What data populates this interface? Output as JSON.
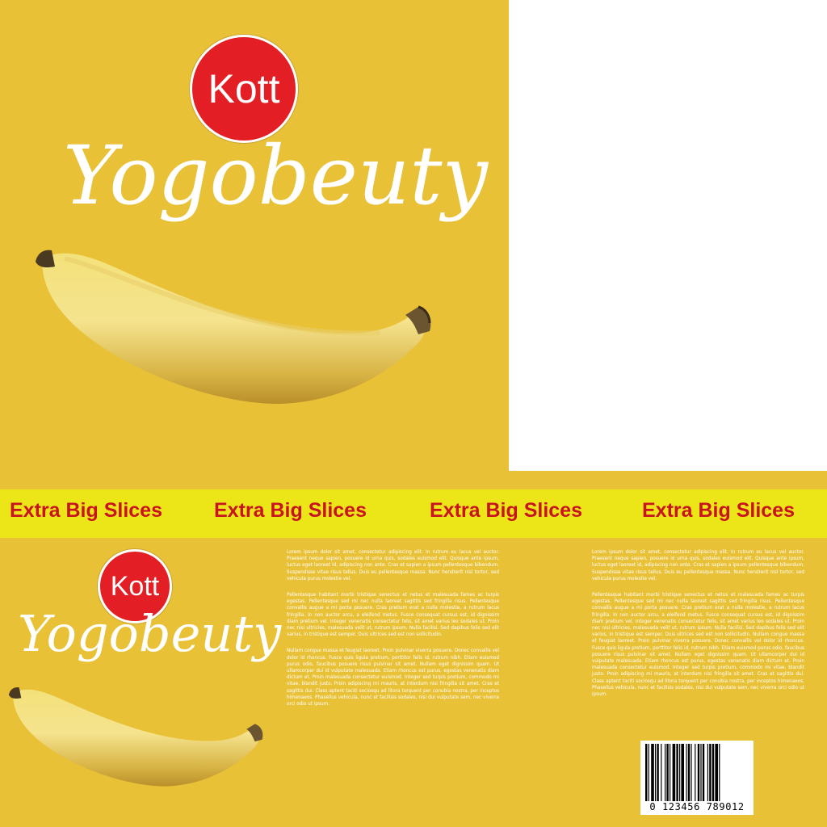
{
  "brand": {
    "logo_text": "Kott",
    "product_name": "Yogobeuty"
  },
  "stripe": {
    "items": [
      "Extra Big Slices",
      "Extra Big Slices",
      "Extra Big Slices",
      "Extra Big Slices"
    ]
  },
  "body_text": {
    "column_1": [
      "Lorem ipsum dolor sit amet, consectetur adipiscing elit. In rutrum eu lacus vel auctor. Praesent neque sapien, posuere id urna quis, sodales euismod elit. Quisque ante ipsum, luctus eget laoreet id, adipiscing non ante. Cras et sapien a ipsum pellentesque bibendum. Suspendisse vitae risus tellus. Duis eu pellentesque massa. Nunc hendrerit nisl tortor, sed vehicula purus molestie vel.",
      "Pellentesque habitant morbi tristique senectus et netus et malesuada fames ac turpis egestas. Pellentesque sed mi nec nulla laoreet sagittis sed fringilla risus. Pellentesque convallis augue a mi porta posuere. Cras pretium erat a nulla molestie, a rutrum lacus fringilla. In non auctor arcu, a eleifend metus. Fusce consequat cursus est, id dignissim diam pretium vel. Integer venenatis consectetur felis, sit amet varius leo sodales ut. Proin nec nisi ultricies, malesuada velit ut, rutrum ipsum. Nulla facilisi. Sed dapibus felis sed elit varius, in tristique est semper. Duis ultrices sed est non sollicitudin.",
      "Nullam congue massa et feugiat laoreet. Proin pulvinar viverra posuere. Donec convallis vel dolor id rhoncus. Fusce quis ligula pretium, porttitor felis id, rutrum nibh. Etiam euismod purus odio, faucibus posuere risus pulvinar sit amet. Nullam eget dignissim quam. Ut ullamcorper dui id vulputate malesuada. Etiam rhoncus est purus, egestas venenatis diam dictum et. Proin malesuada consectetur euismod. Integer sed turpis pretium, commodo mi vitae, blandit justo. Proin adipiscing mi mauris, at interdum nisi fringilla sit amet. Cras et sagittis dui. Class aptent taciti sociosqu ad litora torquent per conubia nostra, per inceptos himenaeos. Phasellus vehicula, nunc et facilisis sodales, nisi dui vulputate sem, nec viverra orci odio ut ipsum."
    ],
    "column_2": [
      "Lorem ipsum dolor sit amet, consectetur adipiscing elit. In rutrum eu lacus vel auctor. Praesent neque sapien, posuere id urna quis, sodales euismod elit. Quisque ante ipsum, luctus eget laoreet id, adipiscing non ante. Cras et sapien a ipsum pellentesque bibendum. Suspendisse vitae risus tellus. Duis eu pellentesque massa. Nunc hendrerit nisl tortor, sed vehicula purus molestie vel.",
      "Pellentesque habitant morbi tristique senectus et netus et malesuada fames ac turpis egestas. Pellentesque sed mi nec nulla laoreet sagittis sed fringilla risus. Pellentesque convallis augue a mi porta posuere. Cras pretium erat a nulla molestie, a rutrum lacus fringilla. In non auctor arcu, a eleifend metus. Fusce consequat cursus est, id dignissim diam pretium vel. Integer venenatis consectetur felis, sit amet varius leo sodales ut. Proin nec nisi ultricies, malesuada velit ut, rutrum ipsum. Nulla facilisi. Sed dapibus felis sed elit varius, in tristique est semper. Duis ultrices sed est non sollicitudin. Nullam congue massa et feugiat laoreet. Proin pulvinar viverra posuere. Donec convallis vel dolor id rhoncus. Fusce quis ligula pretium, porttitor felis id, rutrum nibh. Etiam euismod purus odio, faucibus posuere risus pulvinar sit amet. Nullam eget dignissim quam. Ut ullamcorper dui id vulputate malesuada. Etiam rhoncus est purus, egestas venenatis diam dictum et. Proin malesuada consectetur euismod. Integer sed turpis pretium, commodo mi vitae, blandit justo. Proin adipiscing mi mauris, at interdum nisi fringilla sit amet. Cras et sagittis dui. Class aptent taciti sociosqu ad litora torquent per conubia nostra, per inceptos himenaeos. Phasellus vehicula, nunc et facilisis sodales, nisi dui vulputate sem, nec viverra orci odio ut ipsum."
    ]
  },
  "barcode": {
    "digits": "0 123456 789012"
  },
  "colors": {
    "background": "#e9c137",
    "stripe": "#ece619",
    "stripe_text": "#c8141e",
    "logo_red": "#e31e24"
  }
}
